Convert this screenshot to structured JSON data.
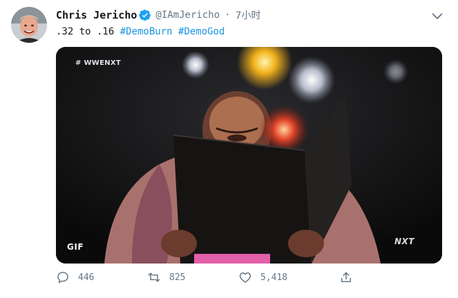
{
  "tweet": {
    "display_name": "Chris Jericho",
    "handle": "@IAmJericho",
    "separator": "·",
    "time": "7小时",
    "text_plain": ".32 to .16 ",
    "hashtags": [
      "#DemoBurn",
      "#DemoGod"
    ],
    "media": {
      "badge": "GIF",
      "watermark_top": "# WWENXT",
      "watermark_logo": "NXT"
    },
    "actions": {
      "reply_count": "446",
      "retweet_count": "825",
      "like_count": "5,418"
    }
  },
  "colors": {
    "link": "#1b95e0",
    "muted": "#657786",
    "verified": "#1da1f2"
  },
  "icons": [
    "avatar",
    "verified-badge-icon",
    "chevron-down-icon",
    "reply-icon",
    "retweet-icon",
    "like-icon",
    "share-icon"
  ]
}
